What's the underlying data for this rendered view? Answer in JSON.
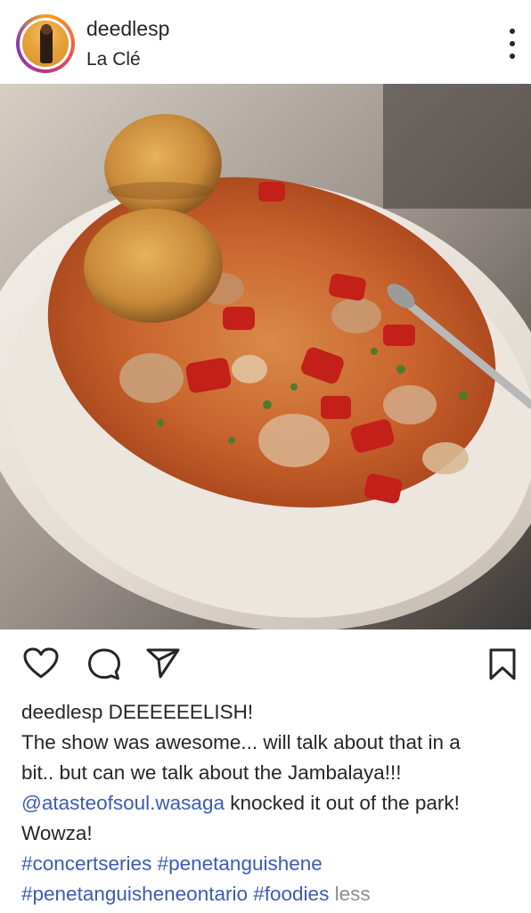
{
  "post": {
    "username": "deedlesp",
    "location": "La Clé",
    "icons": {
      "more": "more-options-icon",
      "like": "heart-icon",
      "comment": "comment-icon",
      "share": "paper-plane-icon",
      "save": "bookmark-icon"
    },
    "photo": {
      "alt_subject": "bowl of jambalaya with cornbread croutons"
    },
    "caption": {
      "author": "deedlesp",
      "headline": " DEEEEEELISH!",
      "line1": "The show was awesome... will talk about that in a",
      "line2": "bit.. but can we talk about the Jambalaya!!!",
      "mention": "@atasteofsoul.wasaga",
      "after_mention": " knocked it out of the park!",
      "line4": "Wowza!",
      "hashtags_line1": [
        "#concertseries",
        "#penetanguishene"
      ],
      "hashtags_line2": [
        "#penetanguisheneontario",
        "#foodies"
      ],
      "less_label": "less"
    },
    "colors": {
      "text": "#262626",
      "link": "#3b5bb5",
      "muted": "#8e8e8e"
    }
  }
}
